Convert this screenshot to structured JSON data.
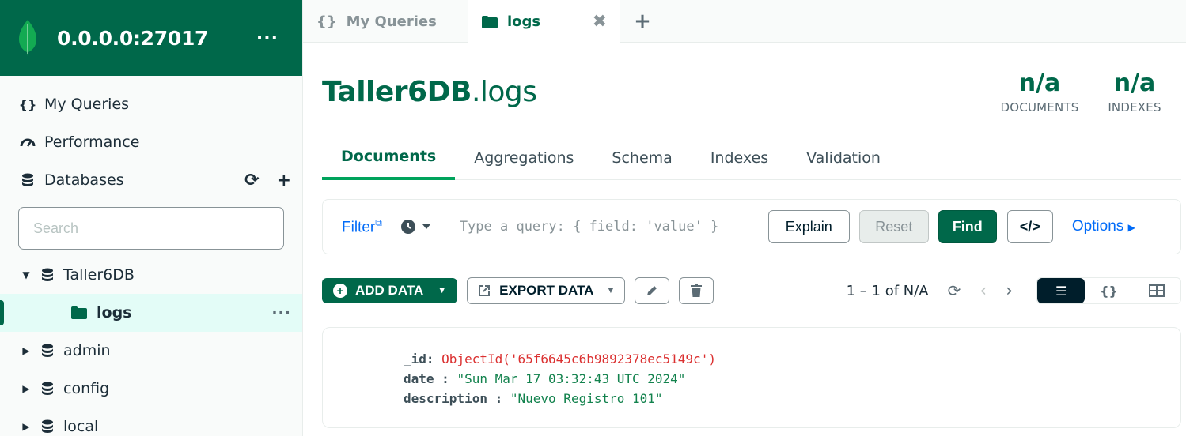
{
  "connection": {
    "title": "0.0.0.0:27017",
    "menu": "···"
  },
  "sidebar": {
    "nav": [
      {
        "label": "My Queries",
        "icon": "curly-braces-icon"
      },
      {
        "label": "Performance",
        "icon": "gauge-icon"
      },
      {
        "label": "Databases",
        "icon": "database-icon"
      }
    ],
    "search_placeholder": "Search",
    "tree": [
      {
        "label": "Taller6DB",
        "expanded": true
      },
      {
        "label": "logs",
        "collection": true
      },
      {
        "label": "admin",
        "expanded": false
      },
      {
        "label": "config",
        "expanded": false
      },
      {
        "label": "local",
        "expanded": false
      }
    ]
  },
  "tabs": [
    {
      "label": "My Queries"
    },
    {
      "label": "logs",
      "active": true
    }
  ],
  "collection": {
    "db": "Taller6DB",
    "name": ".logs",
    "stats": [
      {
        "value": "n/a",
        "label": "DOCUMENTS"
      },
      {
        "value": "n/a",
        "label": "INDEXES"
      }
    ]
  },
  "subtabs": [
    "Documents",
    "Aggregations",
    "Schema",
    "Indexes",
    "Validation"
  ],
  "query": {
    "filter_label": "Filter",
    "placeholder": "Type a query: { field: 'value' }",
    "explain": "Explain",
    "reset": "Reset",
    "find": "Find",
    "code": "</>",
    "options": "Options"
  },
  "toolbar": {
    "add_data": "ADD DATA",
    "export_data": "EXPORT DATA",
    "paging": "1 – 1 of N/A"
  },
  "document": {
    "fields": [
      {
        "key": "_id",
        "value": "ObjectId('65f6645c6b9892378ec5149c')",
        "kind": "oid"
      },
      {
        "key": "date",
        "value": "\"Sun Mar 17 03:32:43 UTC 2024\"",
        "kind": "string"
      },
      {
        "key": "description",
        "value": "\"Nuevo Registro 101\"",
        "kind": "string"
      }
    ]
  },
  "colors": {
    "brand_green": "#00684a",
    "accent_green": "#00a35c",
    "link_blue": "#016bf8",
    "oid_red": "#db3030"
  }
}
